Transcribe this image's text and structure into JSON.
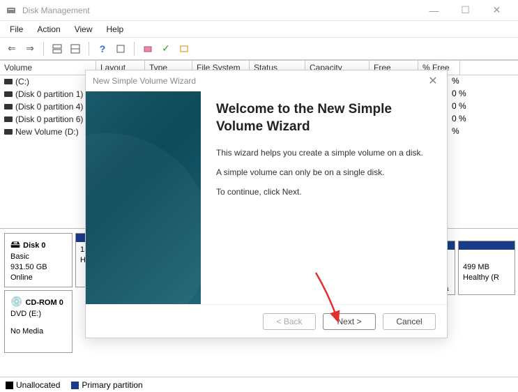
{
  "titlebar": {
    "title": "Disk Management"
  },
  "menu": {
    "file": "File",
    "action": "Action",
    "view": "View",
    "help": "Help"
  },
  "columns": {
    "volume": "Volume",
    "layout": "Layout",
    "type": "Type",
    "filesystem": "File System",
    "status": "Status",
    "capacity": "Capacity",
    "freespace": "Free Spa...",
    "pctfree": "% Free"
  },
  "volumes": [
    {
      "name": "(C:)",
      "pct": "%"
    },
    {
      "name": "(Disk 0 partition 1)",
      "pct": "0 %"
    },
    {
      "name": "(Disk 0 partition 4)",
      "pct": "0 %"
    },
    {
      "name": "(Disk 0 partition 6)",
      "pct": "0 %"
    },
    {
      "name": "New Volume (D:)",
      "pct": "%"
    }
  ],
  "disk0": {
    "name": "Disk 0",
    "type": "Basic",
    "size": "931.50 GB",
    "status": "Online",
    "p1a": "1(",
    "p1b": "H",
    "p2a": ":)",
    "p2b": "ta Pa",
    "p3a": "499 MB",
    "p3b": "Healthy (R"
  },
  "cdrom": {
    "name": "CD-ROM 0",
    "drive": "DVD (E:)",
    "status": "No Media"
  },
  "legend": {
    "unallocated": "Unallocated",
    "primary": "Primary partition"
  },
  "wizard": {
    "title": "New Simple Volume Wizard",
    "heading": "Welcome to the New Simple Volume Wizard",
    "line1": "This wizard helps you create a simple volume on a disk.",
    "line2": "A simple volume can only be on a single disk.",
    "line3": "To continue, click Next.",
    "back": "< Back",
    "next": "Next >",
    "cancel": "Cancel"
  }
}
